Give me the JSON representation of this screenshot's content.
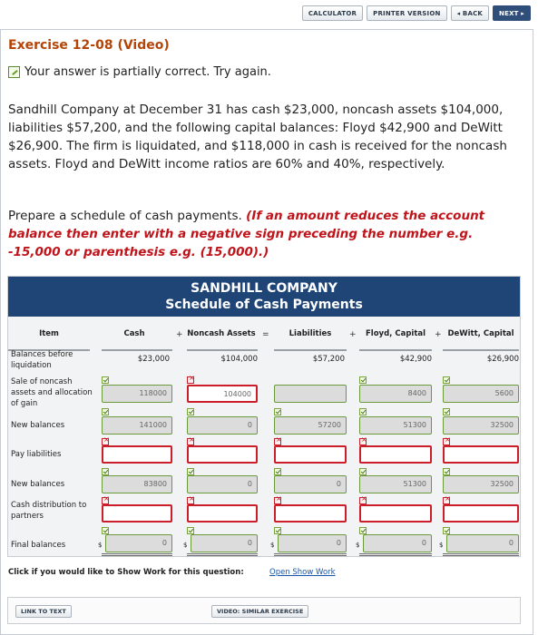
{
  "topbar": {
    "calculator": "CALCULATOR",
    "printer": "PRINTER VERSION",
    "back": "◂ BACK",
    "next": "NEXT ▸"
  },
  "exercise_title": "Exercise 12-08 (Video)",
  "status_text": "Your answer is partially correct.  Try again.",
  "problem_text": "Sandhill Company at December 31 has cash $23,000, noncash assets $104,000, liabilities $57,200, and the following capital balances: Floyd $42,900 and DeWitt $26,900. The firm is liquidated, and $118,000 in cash is received for the noncash assets. Floyd and DeWitt income ratios are 60% and 40%, respectively.",
  "instruction": {
    "plain": "Prepare a schedule of cash payments. ",
    "emphasis": "(If an amount reduces the account balance then enter with a negative sign preceding the number e.g. -15,000 or parenthesis e.g. (15,000).)"
  },
  "schedule": {
    "company": "SANDHILL COMPANY",
    "title": "Schedule of Cash Payments",
    "columns": {
      "item": "Item",
      "cash": "Cash",
      "noncash": "Noncash Assets",
      "liabilities": "Liabilities",
      "floyd": "Floyd, Capital",
      "dewitt": "DeWitt, Capital"
    },
    "operators": {
      "plus1": "+",
      "eq": "=",
      "plus2": "+",
      "plus3": "+"
    },
    "currency": "$",
    "rows": {
      "balances": {
        "label": "Balances before liquidation",
        "cash": "$23,000",
        "noncash": "$104,000",
        "liabilities": "$57,200",
        "floyd": "$42,900",
        "dewitt": "$26,900"
      },
      "sale": {
        "label": "Sale of noncash assets and allocation of gain",
        "cash": "118000",
        "noncash": "104000",
        "liabilities": "",
        "floyd": "8400",
        "dewitt": "5600"
      },
      "new1": {
        "label": "New balances",
        "cash": "141000",
        "noncash": "0",
        "liabilities": "57200",
        "floyd": "51300",
        "dewitt": "32500"
      },
      "pay": {
        "label": "Pay liabilities",
        "cash": "",
        "noncash": "",
        "liabilities": "",
        "floyd": "",
        "dewitt": ""
      },
      "new2": {
        "label": "New balances",
        "cash": "83800",
        "noncash": "0",
        "liabilities": "0",
        "floyd": "51300",
        "dewitt": "32500"
      },
      "dist": {
        "label": "Cash distribution to partners",
        "cash": "",
        "noncash": "",
        "liabilities": "",
        "floyd": "",
        "dewitt": ""
      },
      "final": {
        "label": "Final balances",
        "cash": "0",
        "noncash": "0",
        "liabilities": "0",
        "floyd": "0",
        "dewitt": "0"
      }
    }
  },
  "show_work": {
    "prompt": "Click if you would like to Show Work for this question:",
    "link": "Open Show Work"
  },
  "footer": {
    "link_to_text": "LINK TO TEXT",
    "video": "VIDEO: SIMILAR EXERCISE"
  }
}
